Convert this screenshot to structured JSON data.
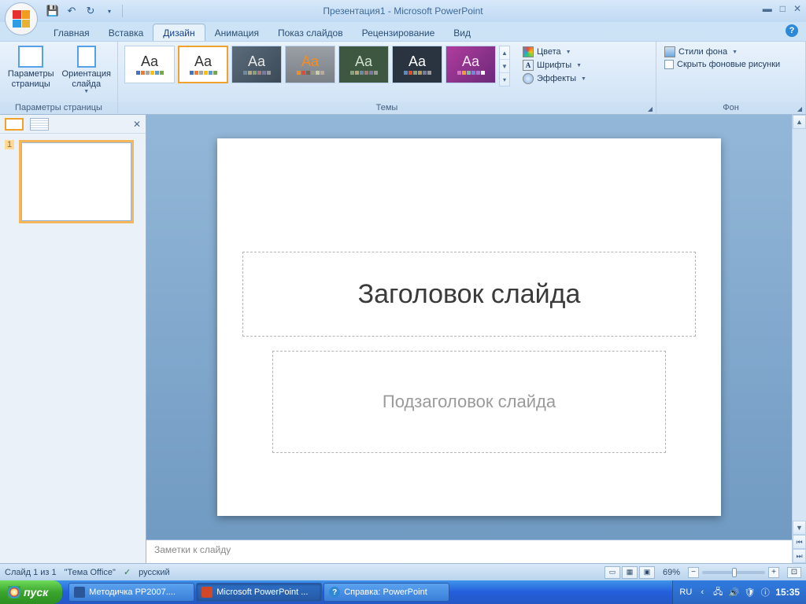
{
  "title": "Презентация1 - Microsoft PowerPoint",
  "tabs": {
    "t0": "Главная",
    "t1": "Вставка",
    "t2": "Дизайн",
    "t3": "Анимация",
    "t4": "Показ слайдов",
    "t5": "Рецензирование",
    "t6": "Вид",
    "active": 2
  },
  "ribbon": {
    "group_page": {
      "label": "Параметры страницы",
      "params": "Параметры\nстраницы",
      "orient": "Ориентация\nслайда"
    },
    "group_themes": {
      "label": "Темы",
      "colors": "Цвета",
      "fonts": "Шрифты",
      "effects": "Эффекты"
    },
    "group_bg": {
      "label": "Фон",
      "styles": "Стили фона",
      "hide": "Скрыть фоновые рисунки"
    }
  },
  "thumbs": {
    "num": "1"
  },
  "slide": {
    "title": "Заголовок слайда",
    "subtitle": "Подзаголовок слайда"
  },
  "notes": "Заметки к слайду",
  "status": {
    "slide": "Слайд 1 из 1",
    "theme": "\"Тема Office\"",
    "lang": "русский",
    "zoom": "69%"
  },
  "taskbar": {
    "start": "пуск",
    "t0": "Методичка РР2007....",
    "t1": "Microsoft PowerPoint ...",
    "t2": "Справка: PowerPoint",
    "lang": "RU",
    "clock": "15:35"
  }
}
